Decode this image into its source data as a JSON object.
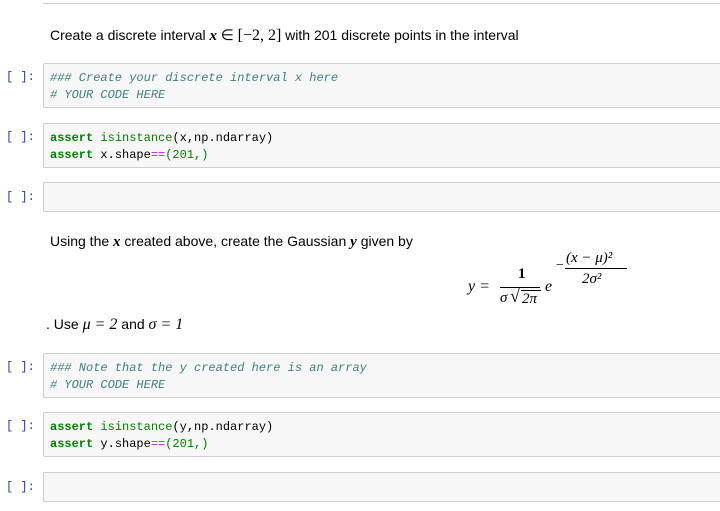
{
  "md1": {
    "before": "Create a discrete interval ",
    "var_x": "x",
    "in_sym": " ∈ ",
    "interval": "[−2, 2]",
    "after": " with 201 discrete points in the interval"
  },
  "cell1": {
    "prompt": "[ ]:",
    "line1": "### Create your discrete interval x here",
    "line2": "# YOUR CODE HERE"
  },
  "cell2": {
    "prompt": "[ ]:",
    "l1_kw": "assert",
    "l1_fn": "isinstance",
    "l1_rest": "(x,np.ndarray)",
    "l2_kw": "assert",
    "l2_mid": " x.shape",
    "l2_op": "==",
    "l2_rest": "(201,)"
  },
  "cell3": {
    "prompt": "[ ]:"
  },
  "md2": {
    "t1": "Using the ",
    "x": "x",
    "t2": " created above, create the Gaussian ",
    "y": "y",
    "t3": " given by",
    "eq_lhs": "y =",
    "frac_num": "1",
    "frac_den_sigma": "σ",
    "frac_den_root": "2π",
    "e": "e",
    "exp_minus": "−",
    "exp_num": "(x − μ)²",
    "exp_den": "2σ²",
    "use_dot": ". Use ",
    "mu_eq": "μ = 2",
    "and": " and ",
    "sigma_eq": "σ = 1"
  },
  "cell4": {
    "prompt": "[ ]:",
    "line1": "### Note that the y created here is an array",
    "line2": "# YOUR CODE HERE"
  },
  "cell5": {
    "prompt": "[ ]:",
    "l1_kw": "assert",
    "l1_fn": "isinstance",
    "l1_rest": "(y,np.ndarray)",
    "l2_kw": "assert",
    "l2_mid": " y.shape",
    "l2_op": "==",
    "l2_rest": "(201,)"
  },
  "cell6": {
    "prompt": "[ ]:"
  }
}
